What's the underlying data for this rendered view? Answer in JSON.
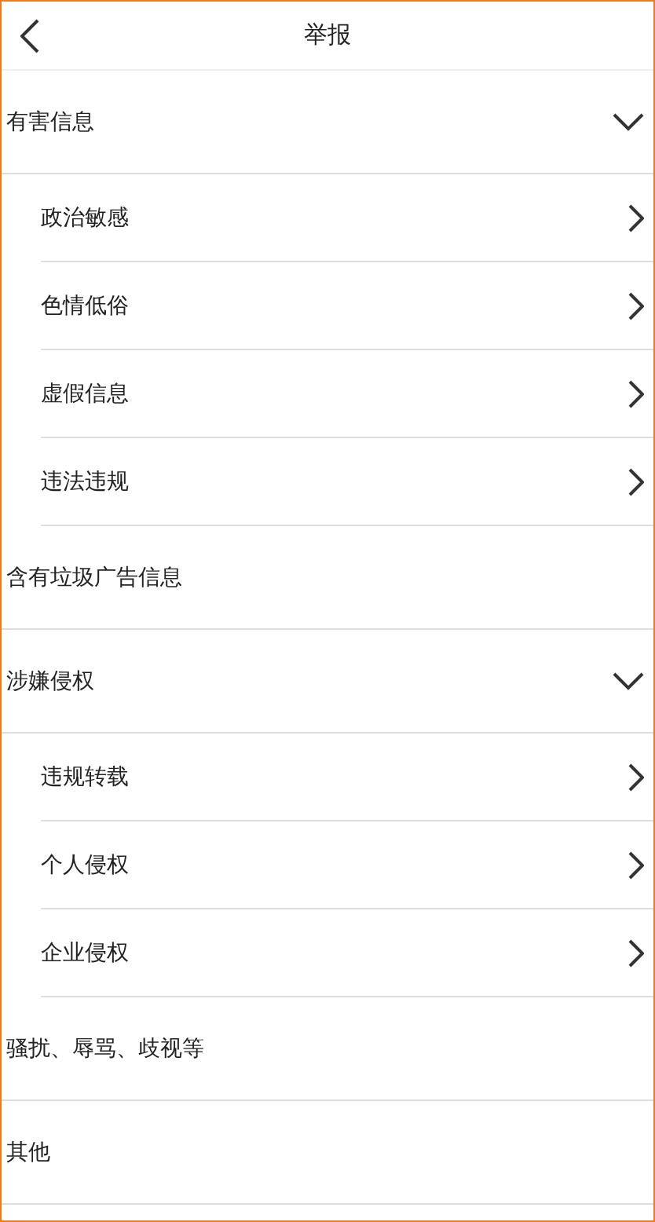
{
  "header": {
    "title": "举报"
  },
  "categories": [
    {
      "kind": "group",
      "label": "有害信息",
      "expanded": true,
      "children": [
        {
          "label": "政治敏感"
        },
        {
          "label": "色情低俗"
        },
        {
          "label": "虚假信息"
        },
        {
          "label": "违法违规"
        }
      ]
    },
    {
      "kind": "item",
      "label": "含有垃圾广告信息"
    },
    {
      "kind": "group",
      "label": "涉嫌侵权",
      "expanded": true,
      "children": [
        {
          "label": "违规转载"
        },
        {
          "label": "个人侵权"
        },
        {
          "label": "企业侵权"
        }
      ]
    },
    {
      "kind": "item",
      "label": "骚扰、辱骂、歧视等"
    },
    {
      "kind": "item",
      "label": "其他"
    }
  ]
}
